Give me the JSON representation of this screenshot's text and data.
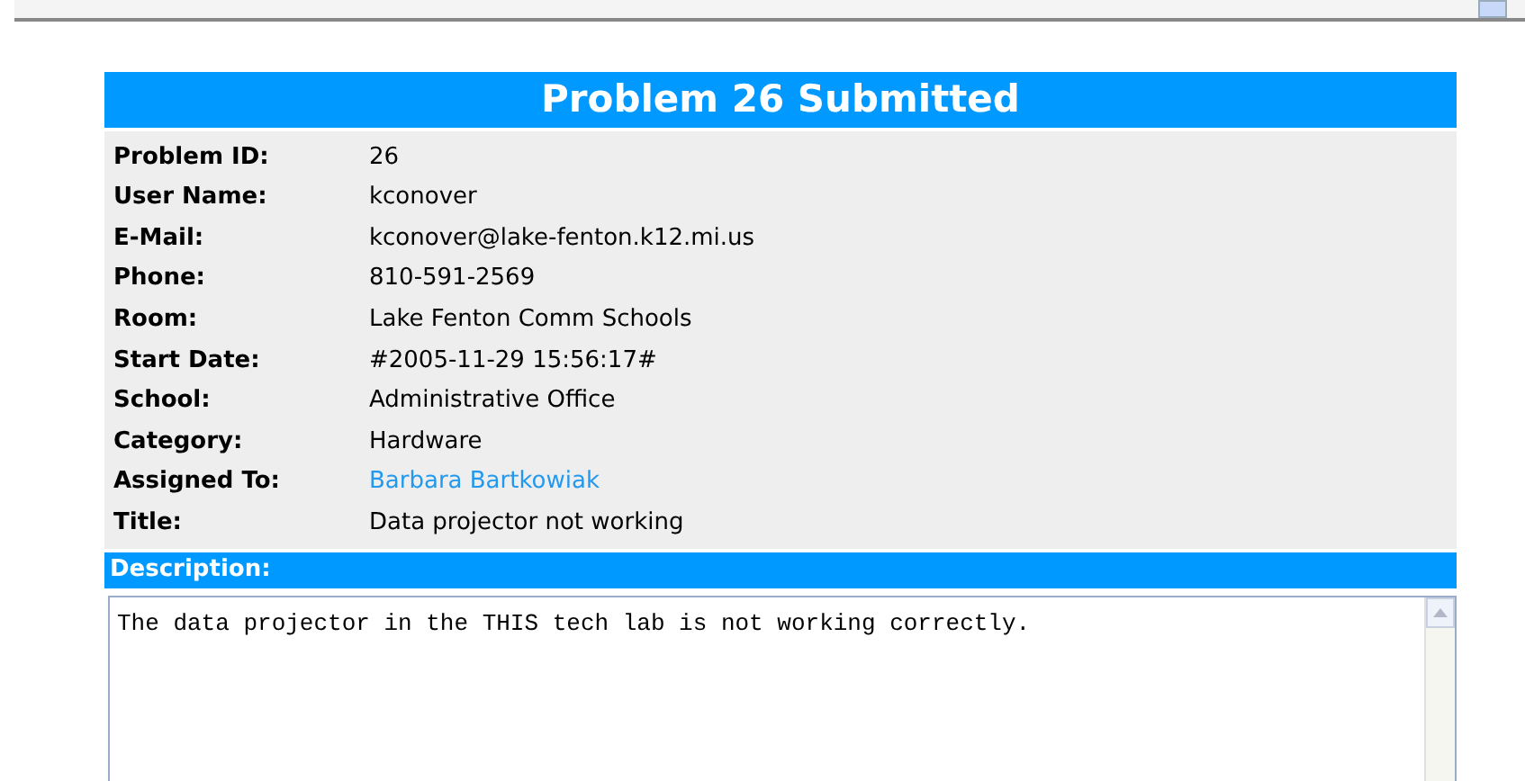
{
  "header": {
    "title": "Problem 26 Submitted"
  },
  "fields": [
    {
      "label": "Problem ID:",
      "value": "26",
      "kind": "text"
    },
    {
      "label": "User Name:",
      "value": "kconover",
      "kind": "text"
    },
    {
      "label": "E-Mail:",
      "value": "kconover@lake-fenton.k12.mi.us",
      "kind": "text"
    },
    {
      "label": "Phone:",
      "value": "810-591-2569",
      "kind": "text"
    },
    {
      "label": "Room:",
      "value": "Lake Fenton Comm Schools",
      "kind": "text"
    },
    {
      "label": "Start Date:",
      "value": "#2005-11-29 15:56:17#",
      "kind": "text"
    },
    {
      "label": "School:",
      "value": "Administrative Office",
      "kind": "text"
    },
    {
      "label": "Category:",
      "value": "Hardware",
      "kind": "text"
    },
    {
      "label": "Assigned To:",
      "value": "Barbara Bartkowiak",
      "kind": "link"
    },
    {
      "label": "Title:",
      "value": "Data projector not working",
      "kind": "text"
    }
  ],
  "description": {
    "heading": "Description:",
    "value": "The data projector in the THIS tech lab is not working correctly."
  }
}
